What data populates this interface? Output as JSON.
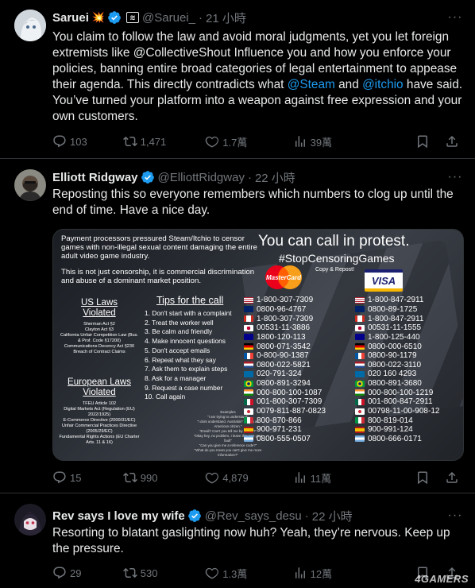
{
  "tweets": [
    {
      "name": "Saruei",
      "name_emoji": "💥",
      "handle": "@Saruei_",
      "time": "21 小時",
      "text_parts": [
        "You claim to follow the law and avoid moral judgments, yet you let foreign extremists like @CollectiveShout Influence you and how you enforce your policies, banning entire broad categories of legal entertainment to appease their agenda. This directly contradicts what ",
        "@Steam",
        " and ",
        "@itchio",
        " have said. You’ve turned your platform into a weapon against free expression and your own customers."
      ],
      "stats": {
        "replies": "103",
        "retweets": "1,471",
        "likes": "1.7萬",
        "views": "39萬"
      }
    },
    {
      "name": "Elliott Ridgway",
      "handle": "@ElliottRidgway",
      "time": "22 小時",
      "text": "Reposting this so everyone remembers which numbers to clog up until the end of time. Have a nice day.",
      "stats": {
        "replies": "15",
        "retweets": "990",
        "likes": "4,879",
        "views": "11萬"
      }
    },
    {
      "name": "Rev says I love my wife",
      "handle": "@Rev_says_desu",
      "time": "22 小時",
      "text": "Resorting to blatant gaslighting now huh? Yeah, they’re nervous. Keep up the pressure.",
      "stats": {
        "replies": "29",
        "retweets": "530",
        "likes": "1.3萬",
        "views": "12萬"
      }
    }
  ],
  "image": {
    "intro": "Payment processors pressured Steam/Itchio to censor games with non-illegal sexual content damaging the entire adult video game industry.",
    "intro2": "This is not just censorship, it is commercial discrimination and abuse of a dominant market position.",
    "headline": "You can call in protest.",
    "hashtag": "#StopCensoringGames",
    "copy_note": "Copy & Repost!",
    "mastercard": "MasterCard",
    "visa": "VISA",
    "us_laws_title": "US Laws Violated",
    "us_laws": "Sherman Act §2\nClayton Act §3\nCalifornia Unfair Competition Law (Bus. & Prof. Code §17200)\nCommunications Decency Act §230\nBreach of Contract Claims",
    "eu_laws_title": "European Laws Violated",
    "eu_laws": "TFEU Article 102\nDigital Markets Act (Regulation (EU) 2022/1925)\nE-Commerce Directive (2000/31/EC)\nUnfair Commercial Practices Directive (2005/29/EC)\nFundamental Rights Actions (EU Charter Arts. 11 & 16)",
    "tips_title": "Tips for the call",
    "tips": [
      "1. Don't start with a complaint",
      "2. Treat the worker well",
      "3. Be calm and friendly",
      "4. Make innocent questions",
      "5. Don't accept emails",
      "6. Repeat what they say",
      "7. Ask them to explain steps",
      "8. Ask for a manager",
      "9. Request a case number",
      "10. Call again"
    ],
    "examples": "Examples\n\"I am trying to understand\"\n\"I dont understand. Australia? but I'm an American citizen.\"\n\"Email? Can't you tell me by phone?\"\n\"Okay hey, no problem, I leave this isn't your fault\"\n\"Can you give me a reference code?\"\n\"What do you mean you can't give me more information?\"",
    "mastercard_numbers": [
      {
        "number": "1-800-307-7309",
        "flag": "us"
      },
      {
        "number": "0800-96-4767",
        "flag": "uk"
      },
      {
        "number": "1-800-307-7309",
        "flag": "ca"
      },
      {
        "number": "00531-11-3886",
        "flag": "jp"
      },
      {
        "number": "1800-120-113",
        "flag": "au"
      },
      {
        "number": "0800-071-3542",
        "flag": "de"
      },
      {
        "number": "0-800-90-1387",
        "flag": "fr"
      },
      {
        "number": "0800-022-5821",
        "flag": "nl"
      },
      {
        "number": "020-791-324",
        "flag": "se"
      },
      {
        "number": "0800-891-3294",
        "flag": "br"
      },
      {
        "number": "000-800-100-1087",
        "flag": "in"
      },
      {
        "number": "001-800-307-7309",
        "flag": "mx"
      },
      {
        "number": "0079-811-887-0823",
        "flag": "kr"
      },
      {
        "number": "800-870-866",
        "flag": "it"
      },
      {
        "number": "900-971-231",
        "flag": "es"
      },
      {
        "number": "0800-555-0507",
        "flag": "ar"
      }
    ],
    "visa_numbers": [
      {
        "number": "1-800-847-2911",
        "flag": "us"
      },
      {
        "number": "0800-89-1725",
        "flag": "uk"
      },
      {
        "number": "1-800-847-2911",
        "flag": "ca"
      },
      {
        "number": "00531-11-1555",
        "flag": "jp"
      },
      {
        "number": "1-800-125-440",
        "flag": "au"
      },
      {
        "number": "0800-000-6510",
        "flag": "de"
      },
      {
        "number": "0800-90-1179",
        "flag": "fr"
      },
      {
        "number": "0800-022-3110",
        "flag": "nl"
      },
      {
        "number": "020 160 4293",
        "flag": "se"
      },
      {
        "number": "0800-891-3680",
        "flag": "br"
      },
      {
        "number": "000-800-100-1219",
        "flag": "in"
      },
      {
        "number": "001-800-847-2911",
        "flag": "mx"
      },
      {
        "number": "00798-11-00-908-12",
        "flag": "kr"
      },
      {
        "number": "800-819-014",
        "flag": "it"
      },
      {
        "number": "900-991-124",
        "flag": "es"
      },
      {
        "number": "0800-666-0171",
        "flag": "ar"
      }
    ]
  },
  "watermark": "4GAMERS",
  "colors": {
    "accent": "#1d9bf0",
    "muted": "#71767b",
    "text": "#e7e9ea",
    "divider": "#2f3336",
    "background": "#000000"
  }
}
